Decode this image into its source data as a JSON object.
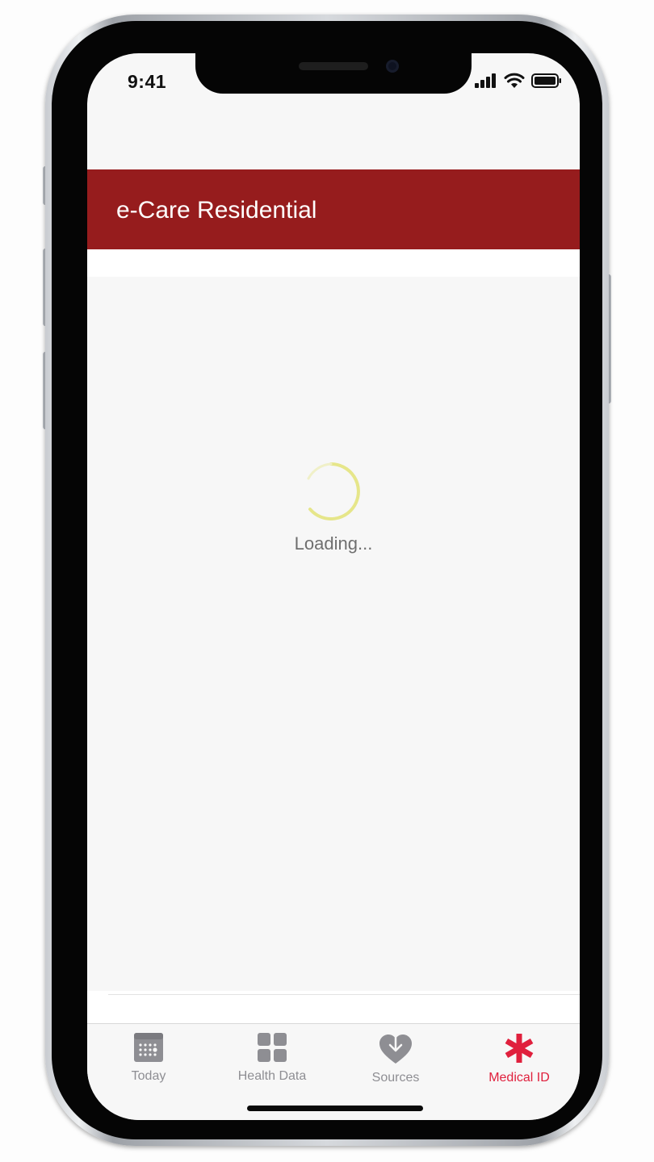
{
  "status_bar": {
    "time": "9:41"
  },
  "header": {
    "title": "e-Care Residential"
  },
  "content": {
    "loading_text": "Loading..."
  },
  "tab_bar": {
    "tabs": [
      {
        "label": "Today",
        "icon": "calendar-icon",
        "active": false
      },
      {
        "label": "Health Data",
        "icon": "grid-icon",
        "active": false
      },
      {
        "label": "Sources",
        "icon": "heart-download-icon",
        "active": false
      },
      {
        "label": "Medical ID",
        "icon": "asterisk-icon",
        "active": true
      }
    ]
  },
  "colors": {
    "header_bg": "#961c1d",
    "active_tab": "#e0203d",
    "inactive_tab": "#8e8e93",
    "spinner": "#e6e68a"
  }
}
